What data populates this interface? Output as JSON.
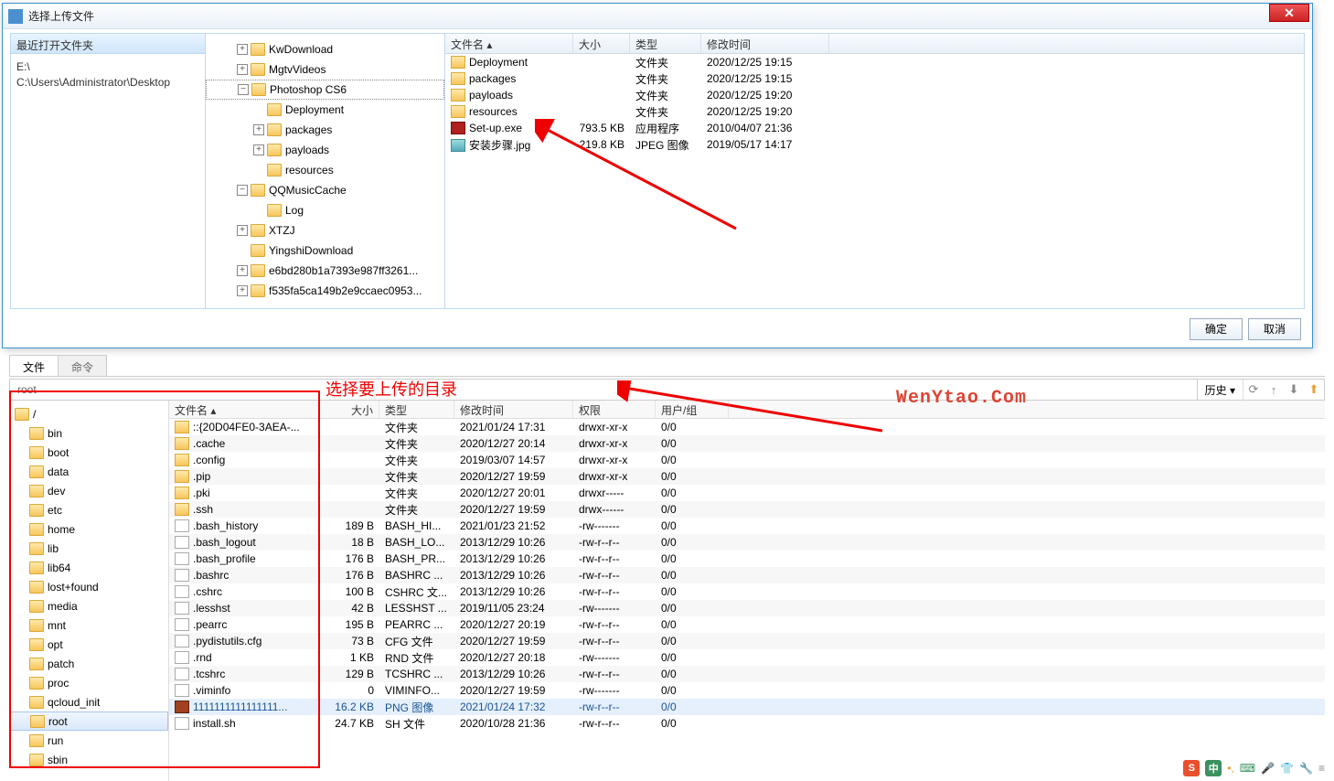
{
  "dialog": {
    "title": "选择上传文件",
    "recent_header": "最近打开文件夹",
    "recent_paths": [
      "E:\\",
      "C:\\Users\\Administrator\\Desktop"
    ],
    "tree": [
      {
        "indent": 1,
        "exp": "+",
        "label": "KwDownload"
      },
      {
        "indent": 1,
        "exp": "+",
        "label": "MgtvVideos"
      },
      {
        "indent": 1,
        "exp": "−",
        "label": "Photoshop CS6",
        "sel": true
      },
      {
        "indent": 2,
        "exp": " ",
        "label": "Deployment"
      },
      {
        "indent": 2,
        "exp": "+",
        "label": "packages"
      },
      {
        "indent": 2,
        "exp": "+",
        "label": "payloads"
      },
      {
        "indent": 2,
        "exp": " ",
        "label": "resources"
      },
      {
        "indent": 1,
        "exp": "−",
        "label": "QQMusicCache"
      },
      {
        "indent": 2,
        "exp": " ",
        "label": "Log"
      },
      {
        "indent": 1,
        "exp": "+",
        "label": "XTZJ"
      },
      {
        "indent": 1,
        "exp": " ",
        "label": "YingshiDownload"
      },
      {
        "indent": 1,
        "exp": "+",
        "label": "e6bd280b1a7393e987ff3261..."
      },
      {
        "indent": 1,
        "exp": "+",
        "label": "f535fa5ca149b2e9ccaec0953..."
      }
    ],
    "cols": {
      "name": "文件名",
      "size": "大小",
      "type": "类型",
      "mtime": "修改时间"
    },
    "files": [
      {
        "icon": "fi-folder",
        "name": "Deployment",
        "size": "",
        "type": "文件夹",
        "mtime": "2020/12/25 19:15"
      },
      {
        "icon": "fi-folder",
        "name": "packages",
        "size": "",
        "type": "文件夹",
        "mtime": "2020/12/25 19:15"
      },
      {
        "icon": "fi-folder",
        "name": "payloads",
        "size": "",
        "type": "文件夹",
        "mtime": "2020/12/25 19:20"
      },
      {
        "icon": "fi-folder",
        "name": "resources",
        "size": "",
        "type": "文件夹",
        "mtime": "2020/12/25 19:20"
      },
      {
        "icon": "fi-app",
        "name": "Set-up.exe",
        "size": "793.5 KB",
        "type": "应用程序",
        "mtime": "2010/04/07 21:36"
      },
      {
        "icon": "fi-img",
        "name": "安装步骤.jpg",
        "size": "219.8 KB",
        "type": "JPEG 图像",
        "mtime": "2019/05/17 14:17"
      }
    ],
    "ok": "确定",
    "cancel": "取消"
  },
  "lower": {
    "tab_file": "文件",
    "tab_cmd": "命令",
    "path": "root",
    "history": "历史",
    "annotation": "选择要上传的目录",
    "root_label": "/",
    "dirs": [
      "bin",
      "boot",
      "data",
      "dev",
      "etc",
      "home",
      "lib",
      "lib64",
      "lost+found",
      "media",
      "mnt",
      "opt",
      "patch",
      "proc",
      "qcloud_init",
      "root",
      "run",
      "sbin"
    ],
    "dirs_sel": "root",
    "rcols": {
      "name": "文件名",
      "size": "大小",
      "type": "类型",
      "mtime": "修改时间",
      "perm": "权限",
      "owner": "用户/组"
    },
    "rfiles": [
      {
        "icon": "fi-folder",
        "name": "::{20D04FE0-3AEA-...",
        "size": "",
        "type": "文件夹",
        "mtime": "2021/01/24 17:31",
        "perm": "drwxr-xr-x",
        "owner": "0/0"
      },
      {
        "icon": "fi-folder",
        "name": ".cache",
        "size": "",
        "type": "文件夹",
        "mtime": "2020/12/27 20:14",
        "perm": "drwxr-xr-x",
        "owner": "0/0"
      },
      {
        "icon": "fi-folder",
        "name": ".config",
        "size": "",
        "type": "文件夹",
        "mtime": "2019/03/07 14:57",
        "perm": "drwxr-xr-x",
        "owner": "0/0"
      },
      {
        "icon": "fi-folder",
        "name": ".pip",
        "size": "",
        "type": "文件夹",
        "mtime": "2020/12/27 19:59",
        "perm": "drwxr-xr-x",
        "owner": "0/0"
      },
      {
        "icon": "fi-folder",
        "name": ".pki",
        "size": "",
        "type": "文件夹",
        "mtime": "2020/12/27 20:01",
        "perm": "drwxr-----",
        "owner": "0/0"
      },
      {
        "icon": "fi-folder",
        "name": ".ssh",
        "size": "",
        "type": "文件夹",
        "mtime": "2020/12/27 19:59",
        "perm": "drwx------",
        "owner": "0/0"
      },
      {
        "icon": "fi-file",
        "name": ".bash_history",
        "size": "189 B",
        "type": "BASH_HI...",
        "mtime": "2021/01/23 21:52",
        "perm": "-rw-------",
        "owner": "0/0"
      },
      {
        "icon": "fi-file",
        "name": ".bash_logout",
        "size": "18 B",
        "type": "BASH_LO...",
        "mtime": "2013/12/29 10:26",
        "perm": "-rw-r--r--",
        "owner": "0/0"
      },
      {
        "icon": "fi-file",
        "name": ".bash_profile",
        "size": "176 B",
        "type": "BASH_PR...",
        "mtime": "2013/12/29 10:26",
        "perm": "-rw-r--r--",
        "owner": "0/0"
      },
      {
        "icon": "fi-file",
        "name": ".bashrc",
        "size": "176 B",
        "type": "BASHRC ...",
        "mtime": "2013/12/29 10:26",
        "perm": "-rw-r--r--",
        "owner": "0/0"
      },
      {
        "icon": "fi-file",
        "name": ".cshrc",
        "size": "100 B",
        "type": "CSHRC 文...",
        "mtime": "2013/12/29 10:26",
        "perm": "-rw-r--r--",
        "owner": "0/0"
      },
      {
        "icon": "fi-file",
        "name": ".lesshst",
        "size": "42 B",
        "type": "LESSHST ...",
        "mtime": "2019/11/05 23:24",
        "perm": "-rw-------",
        "owner": "0/0"
      },
      {
        "icon": "fi-file",
        "name": ".pearrc",
        "size": "195 B",
        "type": "PEARRC ...",
        "mtime": "2020/12/27 20:19",
        "perm": "-rw-r--r--",
        "owner": "0/0"
      },
      {
        "icon": "fi-file",
        "name": ".pydistutils.cfg",
        "size": "73 B",
        "type": "CFG 文件",
        "mtime": "2020/12/27 19:59",
        "perm": "-rw-r--r--",
        "owner": "0/0"
      },
      {
        "icon": "fi-file",
        "name": ".rnd",
        "size": "1 KB",
        "type": "RND 文件",
        "mtime": "2020/12/27 20:18",
        "perm": "-rw-------",
        "owner": "0/0"
      },
      {
        "icon": "fi-file",
        "name": ".tcshrc",
        "size": "129 B",
        "type": "TCSHRC ...",
        "mtime": "2013/12/29 10:26",
        "perm": "-rw-r--r--",
        "owner": "0/0"
      },
      {
        "icon": "fi-file",
        "name": ".viminfo",
        "size": "0",
        "type": "VIMINFO...",
        "mtime": "2020/12/27 19:59",
        "perm": "-rw-------",
        "owner": "0/0"
      },
      {
        "icon": "fi-png",
        "name": "1111111111111111...",
        "size": "16.2 KB",
        "type": "PNG 图像",
        "mtime": "2021/01/24 17:32",
        "perm": "-rw-r--r--",
        "owner": "0/0",
        "sel": true
      },
      {
        "icon": "fi-file",
        "name": "install.sh",
        "size": "24.7 KB",
        "type": "SH 文件",
        "mtime": "2020/10/28 21:36",
        "perm": "-rw-r--r--",
        "owner": "0/0"
      }
    ]
  },
  "watermark": "WenYtao.Com",
  "ime": {
    "s_label": "S",
    "zh_label": "中"
  }
}
